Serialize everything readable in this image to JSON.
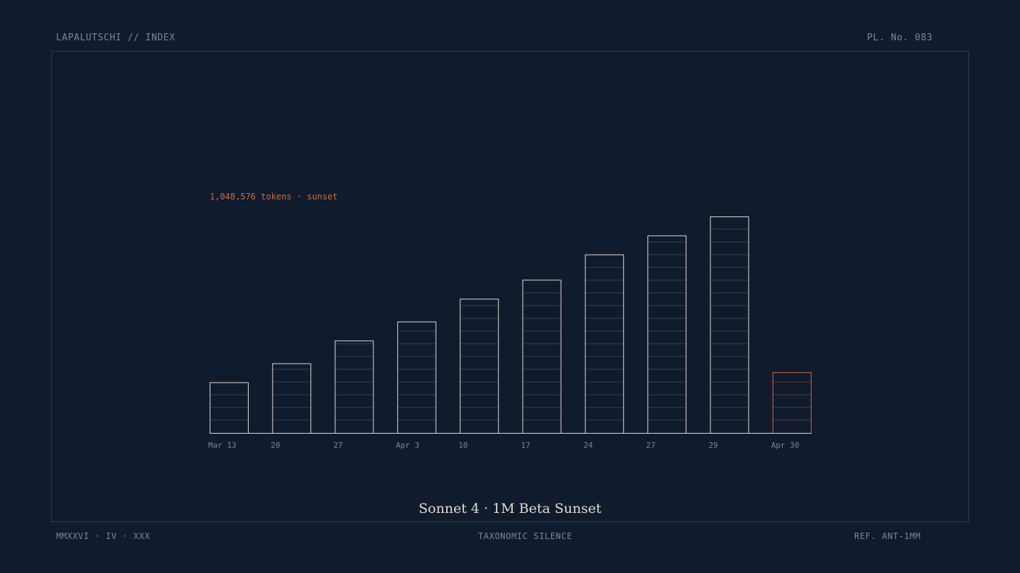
{
  "header": {
    "left": "LAPALUTSCHI // INDEX",
    "right": "PL. No. 083"
  },
  "footer": {
    "left": "MMXXVI · IV · XXX",
    "center": "TAXONOMIC SILENCE",
    "right": "REF. ANT-1MM"
  },
  "colors": {
    "background": "#101b2e",
    "bar_stroke": "#e4dccb",
    "accent": "#d0693f",
    "muted_text": "#7b8698",
    "frame": "#2d3a50"
  },
  "chart_data": {
    "type": "bar",
    "title": "Sonnet 4 · 1M Beta Sunset",
    "categories": [
      "Mar 13",
      "20",
      "27",
      "Apr 3",
      "10",
      "17",
      "24",
      "27",
      "29",
      "Apr 30"
    ],
    "values": [
      4,
      5.5,
      7.3,
      8.8,
      10.6,
      12.1,
      14.1,
      15.6,
      17.1,
      4.8
    ],
    "highlight_index": 9,
    "ylim": [
      0,
      17.1
    ],
    "grid": false,
    "annotation": "1,048,576 tokens · sunset"
  }
}
